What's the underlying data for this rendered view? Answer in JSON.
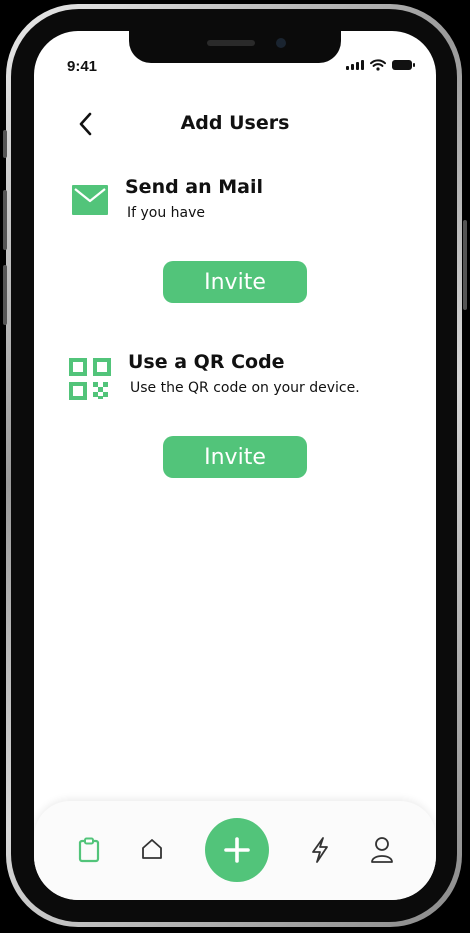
{
  "status_bar": {
    "time": "9:41"
  },
  "header": {
    "title": "Add Users",
    "back_icon": "chevron-left-icon"
  },
  "options": [
    {
      "icon": "mail-icon",
      "title": "Send an Mail",
      "subtitle": "If you have",
      "button_label": "Invite"
    },
    {
      "icon": "qr-code-icon",
      "title": "Use a QR Code",
      "subtitle": "Use the QR code on your device.",
      "button_label": "Invite"
    }
  ],
  "tab_bar": {
    "items": [
      "clipboard-icon",
      "home-icon",
      "add-icon",
      "lightning-icon",
      "user-icon"
    ],
    "active": "clipboard-icon"
  },
  "colors": {
    "accent": "#52c47a",
    "text": "#111111",
    "background": "#ffffff"
  }
}
